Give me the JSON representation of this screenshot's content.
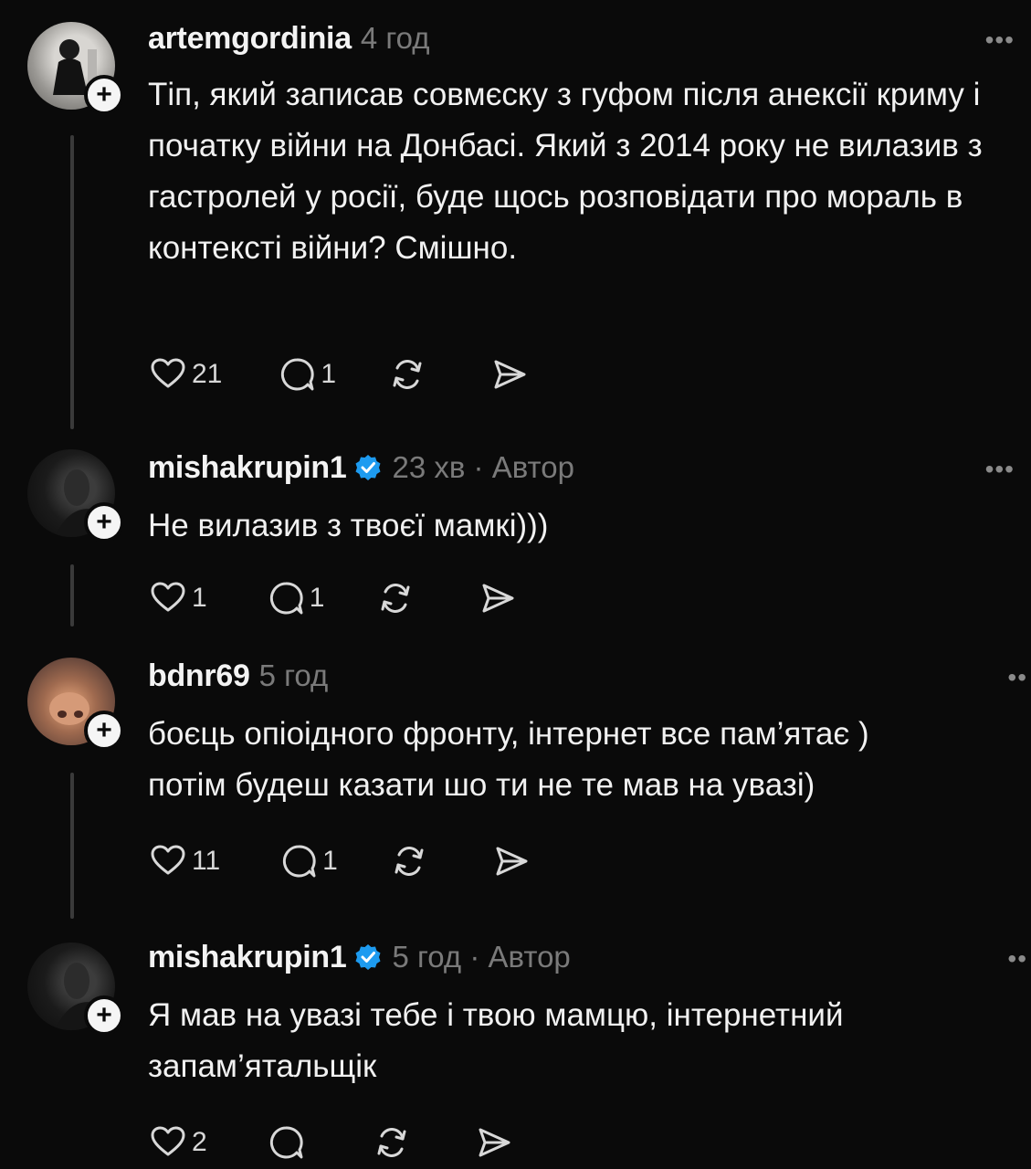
{
  "posts": [
    {
      "username": "artemgordinia",
      "meta": "4 год",
      "verified": false,
      "text": "Тіп, який записав совмєску з гуфом після анексії криму і початку війни на Донбасі. Який з 2014 року не вилазив з гастролей у росії, буде щось розповідати про мораль в контексті війни? Смішно.",
      "likes": "21",
      "replies": "1",
      "more": "•••"
    },
    {
      "username": "mishakrupin1",
      "meta": "23 хв · Автор",
      "verified": true,
      "text": "Не вилазив з твоєї мамкі)))",
      "likes": "1",
      "replies": "1",
      "more": "•••"
    },
    {
      "username": "bdnr69",
      "meta": "5 год",
      "verified": false,
      "text": "боєць опіоідного фронту, інтернет все пам’ятає )\nпотім будеш казати шо ти не те мав на увазі)",
      "likes": "11",
      "replies": "1",
      "more": "••"
    },
    {
      "username": "mishakrupin1",
      "meta": "5 год · Автор",
      "verified": true,
      "text": "Я мав на увазі тебе і твою мамцю, інтернетний запам’ятальщік",
      "likes": "2",
      "replies": "",
      "more": "••"
    }
  ],
  "colors": {
    "background": "#0a0a0a",
    "text": "#f3f3f3",
    "muted": "#7a7a7a",
    "verified": "#1d9bf0",
    "thread_line": "#3a3a3a"
  }
}
